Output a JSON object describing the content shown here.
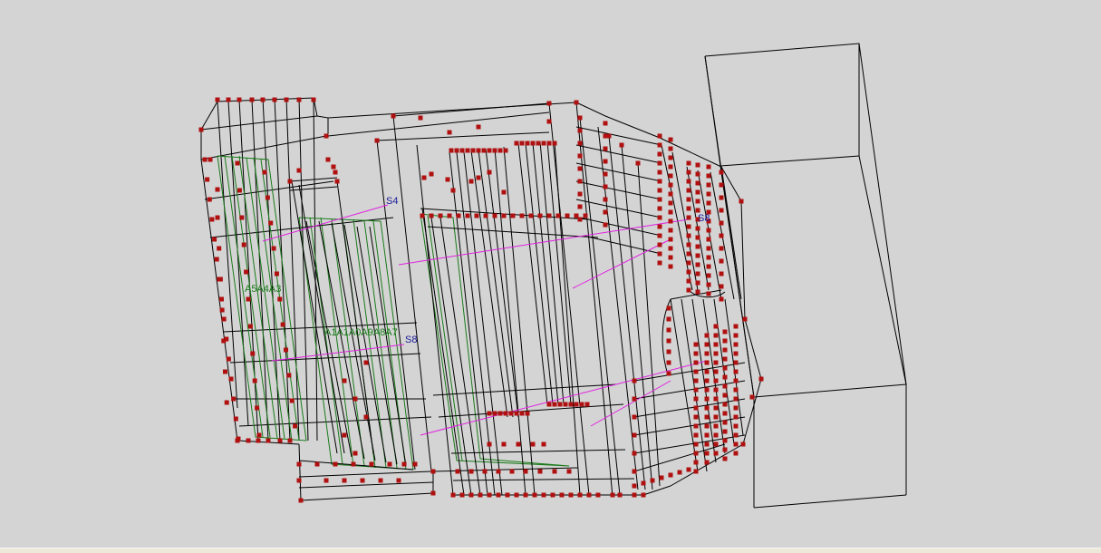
{
  "viewport": {
    "labels": {
      "s4": "S4",
      "s8": "S8",
      "group_a": "A5A4A3",
      "group_b": "A1A1A0A9A8A7",
      "s_right": "S8"
    }
  },
  "colors": {
    "background": "#d4d4d4",
    "wire": "#000000",
    "node": "#b01010",
    "green_wire": "#1a7a1a",
    "magenta_link": "#e020e0",
    "blue_label": "#1a1a9a",
    "green_label": "#1a7a1a",
    "statusbar": "#ece9d8"
  }
}
